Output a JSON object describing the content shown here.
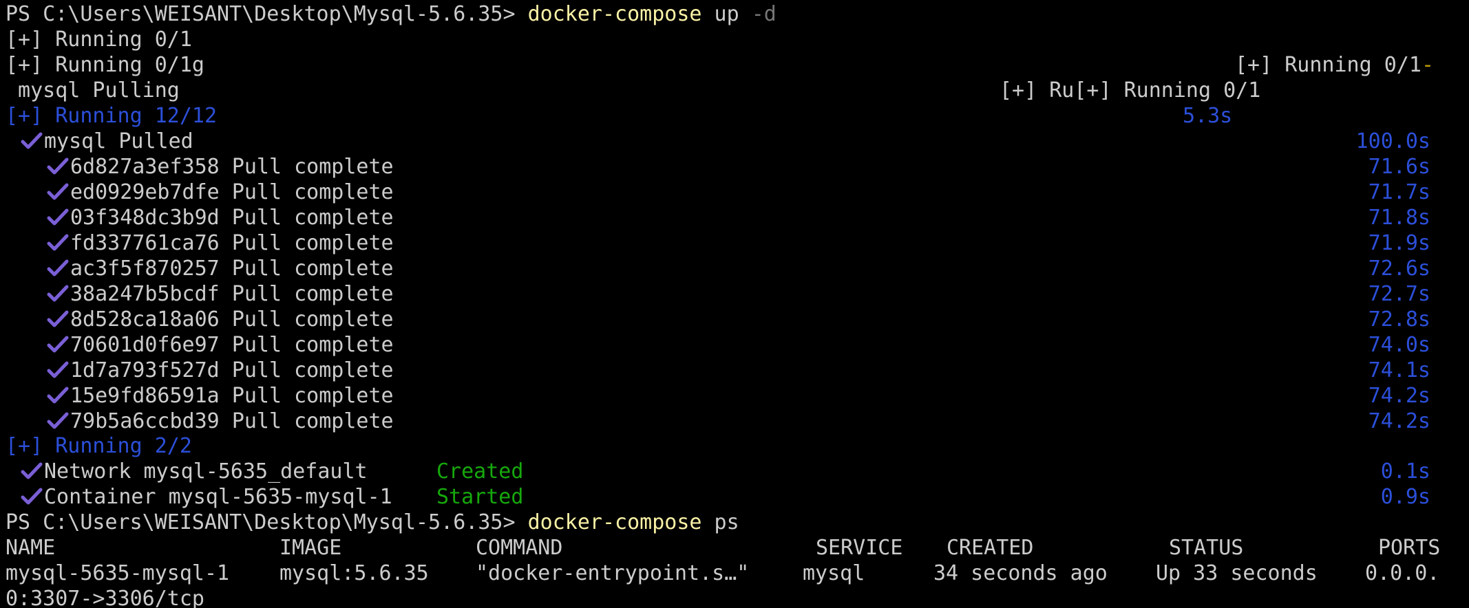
{
  "colors": {
    "background": "#000000",
    "text": "#cccccc",
    "command": "#f9f1a5",
    "flag": "#767676",
    "blue": "#2c4fd9",
    "green": "#16a80c",
    "check": "#7a5fd6",
    "yellow": "#c19c00"
  },
  "prompt1": {
    "path": "PS C:\\Users\\WEISANT\\Desktop\\Mysql-5.6.35> ",
    "cmd": "docker-compose",
    "args": " up ",
    "flag": "-d"
  },
  "progress": {
    "line1": "[+] Running 0/1",
    "line2": "[+] Running 0/1g",
    "line2_right": "[+] Running 0/1",
    "line2_right_tail": "-",
    "line3": " mysql Pulling",
    "line3_right": "[+] Ru[+] Running 0/1",
    "running12": "[+] Running 12/12",
    "running12_time": "5.3s"
  },
  "pulled": {
    "label": "mysql Pulled",
    "time": "100.0s"
  },
  "layers": [
    {
      "id": "6d827a3ef358",
      "status": "Pull complete",
      "time": "71.6s"
    },
    {
      "id": "ed0929eb7dfe",
      "status": "Pull complete",
      "time": "71.7s"
    },
    {
      "id": "03f348dc3b9d",
      "status": "Pull complete",
      "time": "71.8s"
    },
    {
      "id": "fd337761ca76",
      "status": "Pull complete",
      "time": "71.9s"
    },
    {
      "id": "ac3f5f870257",
      "status": "Pull complete",
      "time": "72.6s"
    },
    {
      "id": "38a247b5bcdf",
      "status": "Pull complete",
      "time": "72.7s"
    },
    {
      "id": "8d528ca18a06",
      "status": "Pull complete",
      "time": "72.8s"
    },
    {
      "id": "70601d0f6e97",
      "status": "Pull complete",
      "time": "74.0s"
    },
    {
      "id": "1d7a793f527d",
      "status": "Pull complete",
      "time": "74.1s"
    },
    {
      "id": "15e9fd86591a",
      "status": "Pull complete",
      "time": "74.2s"
    },
    {
      "id": "79b5a6ccbd39",
      "status": "Pull complete",
      "time": "74.2s"
    }
  ],
  "running2": {
    "label": "[+] Running 2/2",
    "network": {
      "label": "Network mysql-5635_default",
      "status": "Created",
      "time": "0.1s"
    },
    "container": {
      "label": "Container mysql-5635-mysql-1",
      "status": "Started",
      "time": "0.9s"
    }
  },
  "prompt2": {
    "path": "PS C:\\Users\\WEISANT\\Desktop\\Mysql-5.6.35> ",
    "cmd": "docker-compose",
    "args": " ps"
  },
  "ps_table": {
    "headers": [
      "NAME",
      "IMAGE",
      "COMMAND",
      "SERVICE",
      "CREATED",
      "STATUS",
      "PORTS"
    ],
    "row": [
      "mysql-5635-mysql-1",
      "mysql:5.6.35",
      "\"docker-entrypoint.s…\"",
      "mysql",
      "34 seconds ago",
      "Up 33 seconds",
      "0.0.0."
    ],
    "wrap": "0:3307->3306/tcp"
  }
}
